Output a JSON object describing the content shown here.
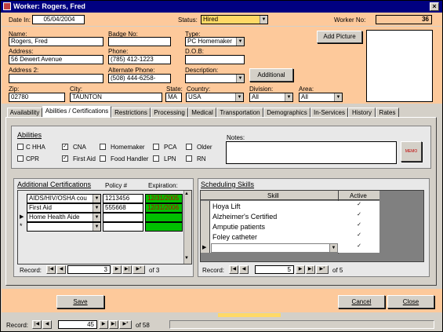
{
  "window": {
    "title": "Worker: Rogers, Fred",
    "close_glyph": "×"
  },
  "header": {
    "date_in_label": "Date In:",
    "date_in": "05/04/2004",
    "status_label": "Status:",
    "status": "Hired",
    "worker_no_label": "Worker No:",
    "worker_no": "36"
  },
  "form": {
    "name_label": "Name:",
    "name": "Rogers, Fred",
    "badge_label": "Badge No:",
    "badge": "",
    "type_label": "Type:",
    "type": "PC Homemaker",
    "add_picture": "Add Picture",
    "address_label": "Address:",
    "address": "56 Dewert Avenue",
    "phone_label": "Phone:",
    "phone": "(785) 412-1223",
    "dob_label": "D.O.B:",
    "dob": "",
    "address2_label": "Address 2:",
    "address2": "",
    "alt_phone_label": "Alternate Phone:",
    "alt_phone": "(508) 444-6258-",
    "description_label": "Description:",
    "description": "",
    "additional": "Additional",
    "zip_label": "Zip:",
    "zip": "02780",
    "city_label": "City:",
    "city": "TAUNTON",
    "state_label": "State:",
    "state": "MA",
    "country_label": "Country:",
    "country": "USA",
    "division_label": "Division:",
    "division": "All",
    "area_label": "Area:",
    "area": "All"
  },
  "tabs": [
    "Availability",
    "Abilities / Certifications",
    "Restrictions",
    "Processing",
    "Medical",
    "Transportation",
    "Demographics",
    "In-Services",
    "History",
    "Rates"
  ],
  "abilities": {
    "title": "Abilities",
    "items": [
      {
        "label": "C HHA",
        "checked": false
      },
      {
        "label": "CNA",
        "checked": true
      },
      {
        "label": "Homemaker",
        "checked": false
      },
      {
        "label": "PCA",
        "checked": false
      },
      {
        "label": "Older",
        "checked": false
      },
      {
        "label": "CPR",
        "checked": false
      },
      {
        "label": "First Aid",
        "checked": true
      },
      {
        "label": "Food Handler",
        "checked": false
      },
      {
        "label": "LPN",
        "checked": false
      },
      {
        "label": "RN",
        "checked": false
      }
    ],
    "notes_label": "Notes:",
    "memo": "MEMO"
  },
  "certs": {
    "title": "Additional Certifications",
    "col_policy": "Policy #",
    "col_exp": "Expiration:",
    "rows": [
      {
        "name": "AIDS/HIV/OSHA cou",
        "policy": "1213456",
        "exp": "12/31/2005"
      },
      {
        "name": "First Aid",
        "policy": "555668",
        "exp": "12/31/2006"
      },
      {
        "name": "Home Health Aide",
        "policy": "",
        "exp": ""
      }
    ],
    "record_label": "Record:",
    "record": "3",
    "of": "of 3"
  },
  "skills": {
    "title": "Scheduling Skills",
    "col_skill": "Skill",
    "col_active": "Active",
    "rows": [
      {
        "name": "Hoya Lift",
        "active": true
      },
      {
        "name": "Alzheimer's Certified",
        "active": true
      },
      {
        "name": "Amputie patients",
        "active": true
      },
      {
        "name": "Foley catheter",
        "active": true
      }
    ],
    "record_label": "Record:",
    "record": "5",
    "of": "of 5"
  },
  "buttons": {
    "save": "Save",
    "cancel": "Cancel",
    "close": "Close"
  },
  "footer": {
    "record_label": "Record:",
    "record": "45",
    "of": "of 58"
  },
  "colors": {
    "peach": "#fdc99b",
    "status": "#ffd966",
    "expiry": "#00c000",
    "title": "#000080"
  }
}
